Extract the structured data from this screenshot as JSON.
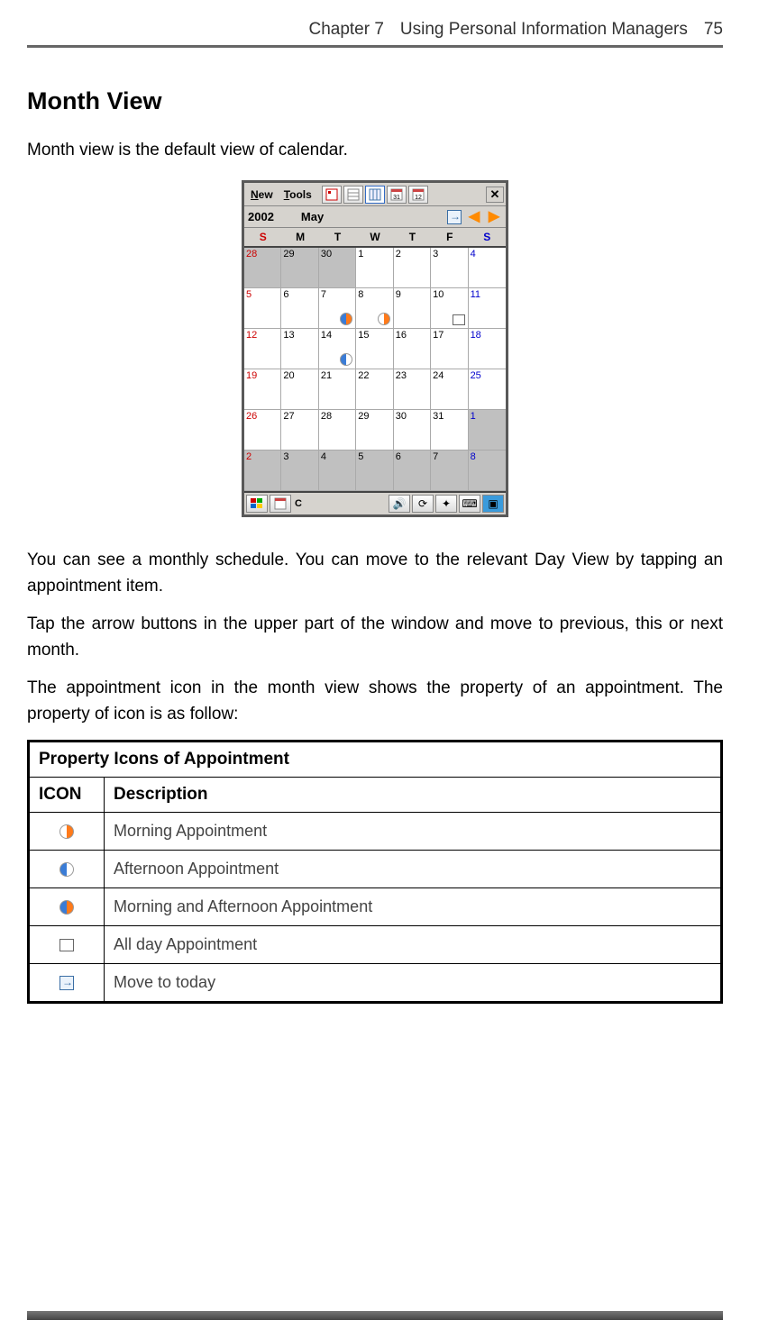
{
  "header": {
    "chapter": "Chapter 7",
    "title": "Using Personal Information Managers",
    "page": "75"
  },
  "section_title": "Month View",
  "intro": "Month view is the default view of calendar.",
  "device": {
    "menu": {
      "new": "New",
      "tools": "Tools"
    },
    "nav": {
      "year": "2002",
      "month": "May"
    },
    "dow": [
      "S",
      "M",
      "T",
      "W",
      "T",
      "F",
      "S"
    ],
    "weeks": [
      [
        {
          "n": "28",
          "out": true,
          "sun": true
        },
        {
          "n": "29",
          "out": true
        },
        {
          "n": "30",
          "out": true
        },
        {
          "n": "1"
        },
        {
          "n": "2"
        },
        {
          "n": "3"
        },
        {
          "n": "4",
          "sat": true
        }
      ],
      [
        {
          "n": "5",
          "sun": true
        },
        {
          "n": "6"
        },
        {
          "n": "7",
          "mark": "both"
        },
        {
          "n": "8",
          "mark": "morning"
        },
        {
          "n": "9"
        },
        {
          "n": "10",
          "mark": "allday"
        },
        {
          "n": "11",
          "sat": true
        }
      ],
      [
        {
          "n": "12",
          "sun": true
        },
        {
          "n": "13"
        },
        {
          "n": "14",
          "mark": "afternoon"
        },
        {
          "n": "15"
        },
        {
          "n": "16"
        },
        {
          "n": "17"
        },
        {
          "n": "18",
          "sat": true
        }
      ],
      [
        {
          "n": "19",
          "sun": true
        },
        {
          "n": "20"
        },
        {
          "n": "21"
        },
        {
          "n": "22"
        },
        {
          "n": "23"
        },
        {
          "n": "24"
        },
        {
          "n": "25",
          "sat": true
        }
      ],
      [
        {
          "n": "26",
          "sun": true
        },
        {
          "n": "27"
        },
        {
          "n": "28"
        },
        {
          "n": "29"
        },
        {
          "n": "30"
        },
        {
          "n": "31"
        },
        {
          "n": "1",
          "out": true,
          "sat": true
        }
      ],
      [
        {
          "n": "2",
          "out": true,
          "sun": true
        },
        {
          "n": "3",
          "out": true
        },
        {
          "n": "4",
          "out": true
        },
        {
          "n": "5",
          "out": true
        },
        {
          "n": "6",
          "out": true
        },
        {
          "n": "7",
          "out": true
        },
        {
          "n": "8",
          "out": true,
          "sat": true
        }
      ]
    ],
    "taskbar_c": "C"
  },
  "paragraphs": {
    "p1": "You can see a monthly schedule. You can move to the relevant Day View by tapping an appointment item.",
    "p2": "Tap the arrow buttons in the upper part of the window and move to previous, this or next month.",
    "p3": "The appointment icon in the month view shows the property of an appointment. The property of icon is as follow:"
  },
  "table": {
    "title": "Property Icons of Appointment",
    "headers": {
      "icon": "ICON",
      "desc": "Description"
    },
    "rows": [
      {
        "icon": "morning",
        "desc": "Morning Appointment"
      },
      {
        "icon": "afternoon",
        "desc": "Afternoon Appointment"
      },
      {
        "icon": "both",
        "desc": "Morning and Afternoon Appointment"
      },
      {
        "icon": "allday",
        "desc": "All day Appointment"
      },
      {
        "icon": "today",
        "desc": "Move to today"
      }
    ]
  }
}
